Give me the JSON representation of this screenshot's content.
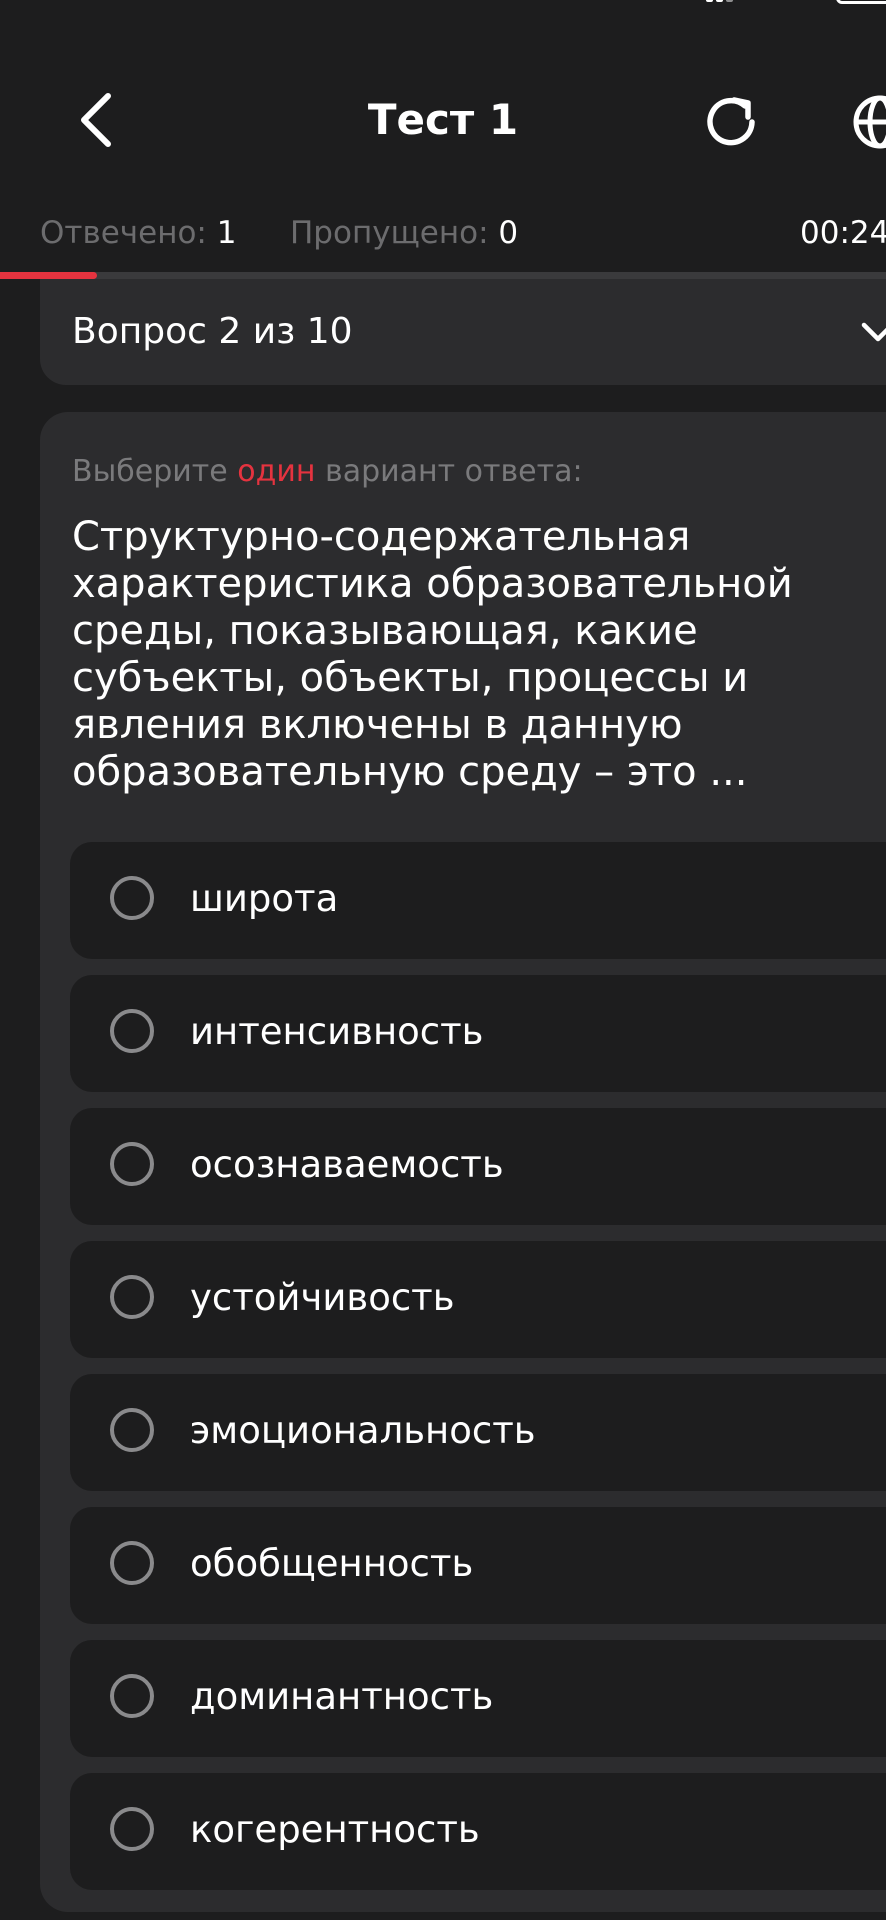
{
  "header": {
    "title": "Тест 1",
    "back_icon": "chevron-left-icon",
    "reload_icon": "reload-icon",
    "language_icon": "globe-icon"
  },
  "stats": {
    "answered_label": "Отвечено:",
    "answered_value": "1",
    "skipped_label": "Пропущено:",
    "skipped_value": "0",
    "timer": "00:24"
  },
  "progress": {
    "fraction": 0.11
  },
  "question_selector": {
    "label": "Вопрос 2 из 10",
    "icon": "chevron-down-icon"
  },
  "question": {
    "instruction_prefix": "Выберите",
    "instruction_highlight": "один",
    "instruction_suffix": "вариант ответа:",
    "text": "Структурно-содержательная характеристика образовательной среды, показывающая, какие субъекты, объекты, процессы и явления включены в данную образовательную среду – это ...",
    "options": [
      {
        "label": "широта"
      },
      {
        "label": "интенсивность"
      },
      {
        "label": "осознаваемость"
      },
      {
        "label": "устойчивость"
      },
      {
        "label": "эмоциональность"
      },
      {
        "label": "обобщенность"
      },
      {
        "label": "доминантность"
      },
      {
        "label": "когерентность"
      }
    ]
  },
  "colors": {
    "background": "#1d1d1e",
    "card": "#2c2c2e",
    "accent": "#e5333f",
    "muted_text": "#6c6c6e"
  }
}
